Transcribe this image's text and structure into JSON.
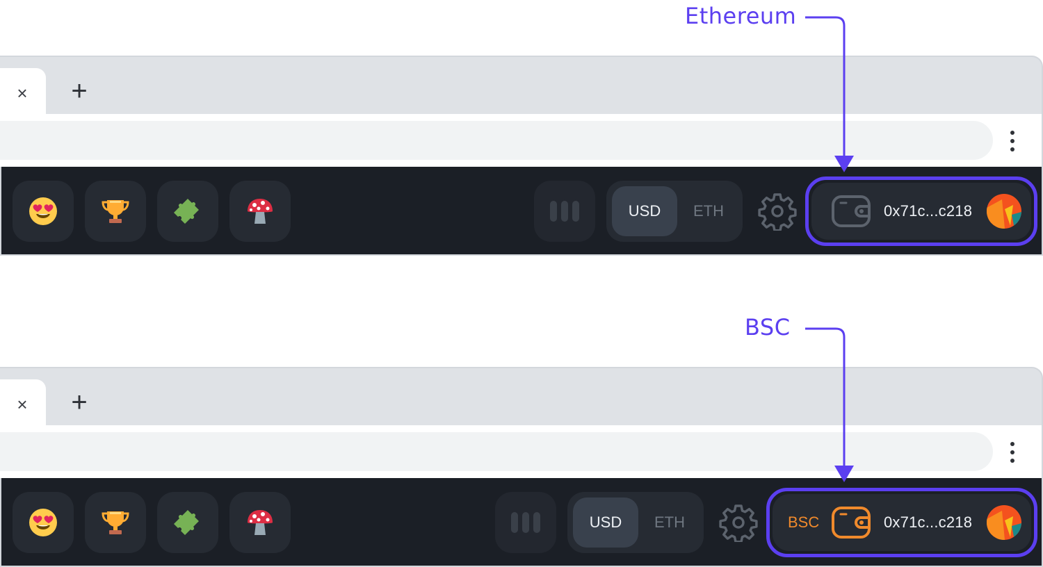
{
  "callouts": [
    {
      "label": "Ethereum"
    },
    {
      "label": "BSC"
    }
  ],
  "browser": {
    "tab_close_icon": "close-icon",
    "new_tab_icon": "plus-icon",
    "menu_icon": "kebab-menu-icon"
  },
  "toolbar": {
    "apps": [
      {
        "icon": "heart-eyes-emoji-icon"
      },
      {
        "icon": "trophy-emoji-icon"
      },
      {
        "icon": "puzzle-piece-emoji-icon"
      },
      {
        "icon": "mushroom-emoji-icon"
      }
    ],
    "chart_toggle_icon": "bars-icon",
    "currency": {
      "options": [
        "USD",
        "ETH"
      ],
      "selected": "USD"
    },
    "settings_icon": "gear-icon"
  },
  "panels": [
    {
      "network_label": "",
      "address": "0x71c...c218",
      "wallet_color": "#5c636d"
    },
    {
      "network_label": "BSC",
      "address": "0x71c...c218",
      "wallet_color": "#f08a2c"
    }
  ],
  "colors": {
    "accent": "#5b3ff0",
    "toolbar_bg": "#1b1f26",
    "bsc_orange": "#f08a2c"
  }
}
